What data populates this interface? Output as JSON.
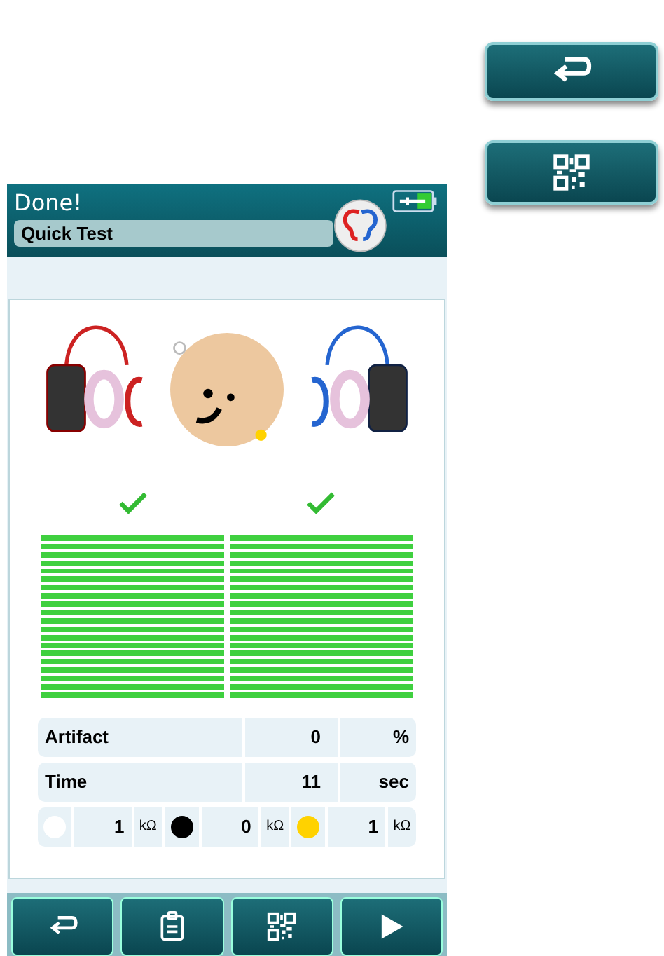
{
  "side_buttons": [
    {
      "kind": "return"
    },
    {
      "kind": "qr"
    }
  ],
  "header": {
    "title": "Done!",
    "test_name": "Quick Test"
  },
  "ears": [
    {
      "passed": true,
      "level": 1
    },
    {
      "passed": true,
      "level": 1
    }
  ],
  "stats": [
    {
      "label": "Artifact",
      "value": "0",
      "unit": "%"
    },
    {
      "label": "Time",
      "value": "11",
      "unit": "sec"
    }
  ],
  "electrodes": [
    {
      "color": "#ffffff",
      "value": "1",
      "unit": "kΩ"
    },
    {
      "color": "#000000",
      "value": "0",
      "unit": "kΩ"
    },
    {
      "color": "#ffd200",
      "value": "1",
      "unit": "kΩ"
    }
  ],
  "toolbar": [
    {
      "kind": "return"
    },
    {
      "kind": "report"
    },
    {
      "kind": "qr"
    },
    {
      "kind": "play"
    }
  ]
}
